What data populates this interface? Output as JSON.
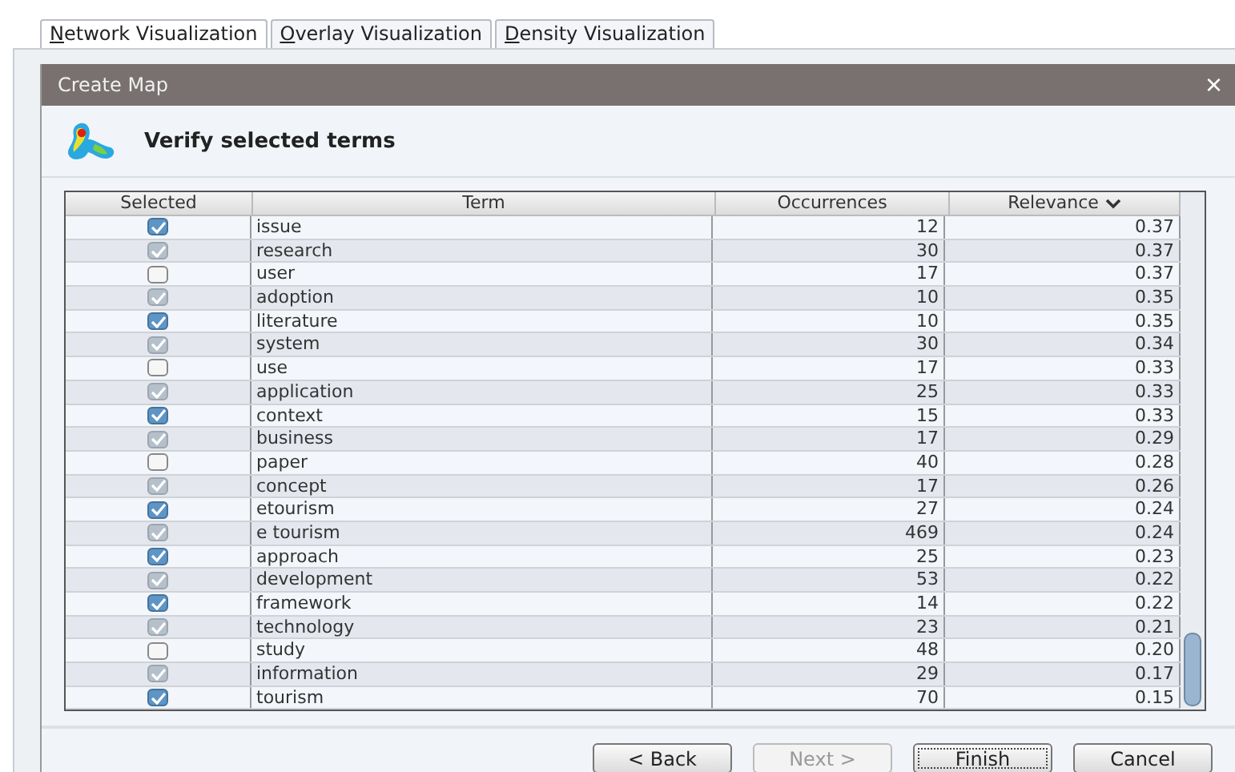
{
  "tabs": [
    {
      "label": "Network Visualization",
      "selected": true
    },
    {
      "label": "Overlay Visualization",
      "selected": false
    },
    {
      "label": "Density Visualization",
      "selected": false
    }
  ],
  "dialog": {
    "title": "Create Map",
    "close": "×",
    "heading": "Verify selected terms"
  },
  "table": {
    "columns": [
      {
        "label": "Selected",
        "sorted": false
      },
      {
        "label": "Term",
        "sorted": false
      },
      {
        "label": "Occurrences",
        "sorted": false
      },
      {
        "label": "Relevance",
        "sorted": true
      }
    ],
    "rows": [
      {
        "checked": true,
        "term": "issue",
        "occurrences": "12",
        "relevance": "0.37"
      },
      {
        "checked": true,
        "term": "research",
        "occurrences": "30",
        "relevance": "0.37"
      },
      {
        "checked": false,
        "term": "user",
        "occurrences": "17",
        "relevance": "0.37"
      },
      {
        "checked": true,
        "term": "adoption",
        "occurrences": "10",
        "relevance": "0.35"
      },
      {
        "checked": true,
        "term": "literature",
        "occurrences": "10",
        "relevance": "0.35"
      },
      {
        "checked": true,
        "term": "system",
        "occurrences": "30",
        "relevance": "0.34"
      },
      {
        "checked": false,
        "term": "use",
        "occurrences": "17",
        "relevance": "0.33"
      },
      {
        "checked": true,
        "term": "application",
        "occurrences": "25",
        "relevance": "0.33"
      },
      {
        "checked": true,
        "term": "context",
        "occurrences": "15",
        "relevance": "0.33"
      },
      {
        "checked": true,
        "term": "business",
        "occurrences": "17",
        "relevance": "0.29"
      },
      {
        "checked": false,
        "term": "paper",
        "occurrences": "40",
        "relevance": "0.28"
      },
      {
        "checked": true,
        "term": "concept",
        "occurrences": "17",
        "relevance": "0.26"
      },
      {
        "checked": true,
        "term": "etourism",
        "occurrences": "27",
        "relevance": "0.24"
      },
      {
        "checked": true,
        "term": "e tourism",
        "occurrences": "469",
        "relevance": "0.24"
      },
      {
        "checked": true,
        "term": "approach",
        "occurrences": "25",
        "relevance": "0.23"
      },
      {
        "checked": true,
        "term": "development",
        "occurrences": "53",
        "relevance": "0.22"
      },
      {
        "checked": true,
        "term": "framework",
        "occurrences": "14",
        "relevance": "0.22"
      },
      {
        "checked": true,
        "term": "technology",
        "occurrences": "23",
        "relevance": "0.21"
      },
      {
        "checked": false,
        "term": "study",
        "occurrences": "48",
        "relevance": "0.20"
      },
      {
        "checked": true,
        "term": "information",
        "occurrences": "29",
        "relevance": "0.17"
      },
      {
        "checked": true,
        "term": "tourism",
        "occurrences": "70",
        "relevance": "0.15"
      }
    ]
  },
  "buttons": [
    {
      "label": "< Back",
      "disabled": false,
      "default": false
    },
    {
      "label": "Next >",
      "disabled": true,
      "default": false
    },
    {
      "label": "Finish",
      "disabled": false,
      "default": true
    },
    {
      "label": "Cancel",
      "disabled": false,
      "default": false
    }
  ]
}
